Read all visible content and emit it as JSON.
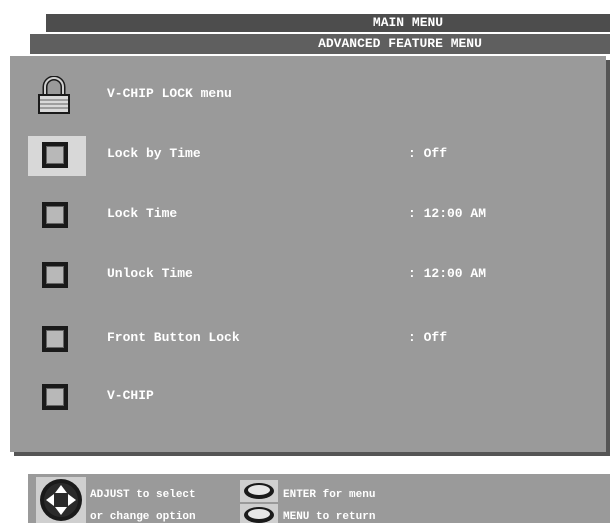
{
  "header": {
    "main_menu": "MAIN MENU",
    "advanced_menu": "ADVANCED FEATURE MENU"
  },
  "title_row": {
    "label": "V-CHIP LOCK menu",
    "icon": "padlock-icon"
  },
  "items": [
    {
      "label": "Lock by Time",
      "value": ": Off",
      "icon": "button-icon",
      "selected": true
    },
    {
      "label": "Lock Time",
      "value": ": 12:00 AM",
      "icon": "button-icon",
      "selected": false
    },
    {
      "label": "Unlock Time",
      "value": ": 12:00 AM",
      "icon": "button-icon",
      "selected": false
    },
    {
      "label": "Front Button Lock",
      "value": ": Off",
      "icon": "button-icon",
      "selected": false
    },
    {
      "label": "V-CHIP",
      "value": "",
      "icon": "button-icon",
      "selected": false
    }
  ],
  "help": {
    "adjust_line1": "ADJUST to select",
    "adjust_line2": "or change option",
    "enter": "ENTER for menu",
    "menu": "MENU to return"
  },
  "colors": {
    "panel": "#9a9a9a",
    "header_dark": "#4d4d4d",
    "text": "#ffffff"
  }
}
